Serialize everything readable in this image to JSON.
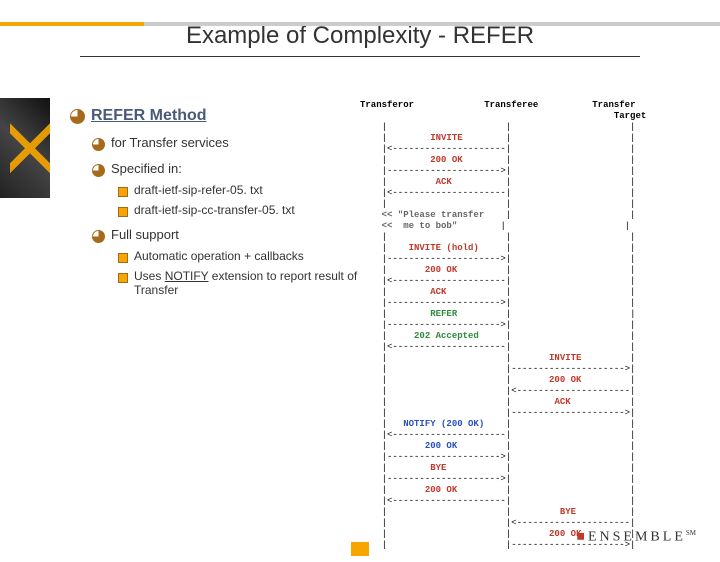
{
  "title": "Example of Complexity - REFER",
  "bullets": {
    "l1": "REFER Method",
    "l2a": "for Transfer services",
    "l2b": "Specified in:",
    "l3a": "draft-ietf-sip-refer-05. txt",
    "l3b": "draft-ietf-sip-cc-transfer-05. txt",
    "l2c": "Full support",
    "l3c": "Automatic operation + callbacks",
    "l3d_pre": "Uses ",
    "l3d_link": "NOTIFY",
    "l3d_post": " extension to report result of Transfer"
  },
  "columns": {
    "a": "Transferor",
    "b": "Transferee",
    "c": "Transfer\n Target"
  },
  "msgs": {
    "invite1": "INVITE",
    "ok1": "200 OK",
    "ack1": "ACK",
    "prompt1": "<< \"Please transfer",
    "prompt2": "<<  me to bob\"",
    "invhold": "INVITE (hold)",
    "ok2": "200 OK",
    "ack2": "ACK",
    "refer": "REFER",
    "accepted": "202 Accepted",
    "invite2": "INVITE",
    "ok3": "200 OK",
    "ack3": "ACK",
    "notify": "NOTIFY (200 OK)",
    "ok4": "200 OK",
    "bye1": "BYE",
    "ok5": "200 OK",
    "bye2": "BYE",
    "ok6": "200 OK"
  },
  "logo": "ENSEMBLE"
}
